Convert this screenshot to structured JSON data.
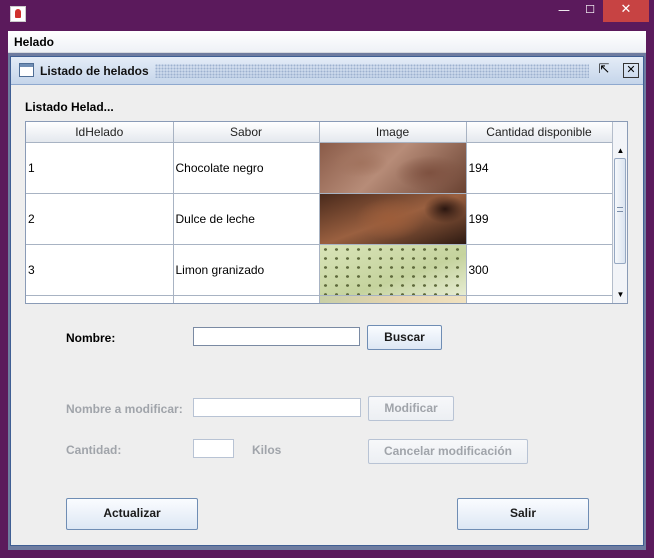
{
  "window": {
    "controls": {
      "minimize": "—",
      "maximize": "☐",
      "close": "✕"
    }
  },
  "menubar": {
    "items": [
      "Helado"
    ]
  },
  "internal_frame": {
    "title": "Listado de helados",
    "controls": {
      "maximize": "⇱",
      "close": "✕"
    }
  },
  "panel": {
    "title": "Listado Helad..."
  },
  "table": {
    "columns": [
      "IdHelado",
      "Sabor",
      "Image",
      "Cantidad disponible"
    ],
    "rows": [
      {
        "id": "1",
        "sabor": "Chocolate negro",
        "image": "chocolate-ice-cream",
        "cantidad": "194"
      },
      {
        "id": "2",
        "sabor": "Dulce de leche",
        "image": "dulce-de-leche-ice-cream",
        "cantidad": "199"
      },
      {
        "id": "3",
        "sabor": "Limon granizado",
        "image": "lemon-granita-ice-cream",
        "cantidad": "300"
      }
    ]
  },
  "form": {
    "nombre_label": "Nombre:",
    "nombre_value": "",
    "buscar_label": "Buscar",
    "modificar_label_text": "Nombre a modificar:",
    "modificar_value": "",
    "modificar_button": "Modificar",
    "cantidad_label": "Cantidad:",
    "cantidad_value": "",
    "kilos_label": "Kilos",
    "cancelar_button": "Cancelar modificación",
    "actualizar_button": "Actualizar",
    "salir_button": "Salir"
  },
  "colors": {
    "titlebar": "#5b1a5c",
    "close_button": "#c74343",
    "desktop": "#6e7ca0",
    "frame_border": "#3f5f94"
  }
}
